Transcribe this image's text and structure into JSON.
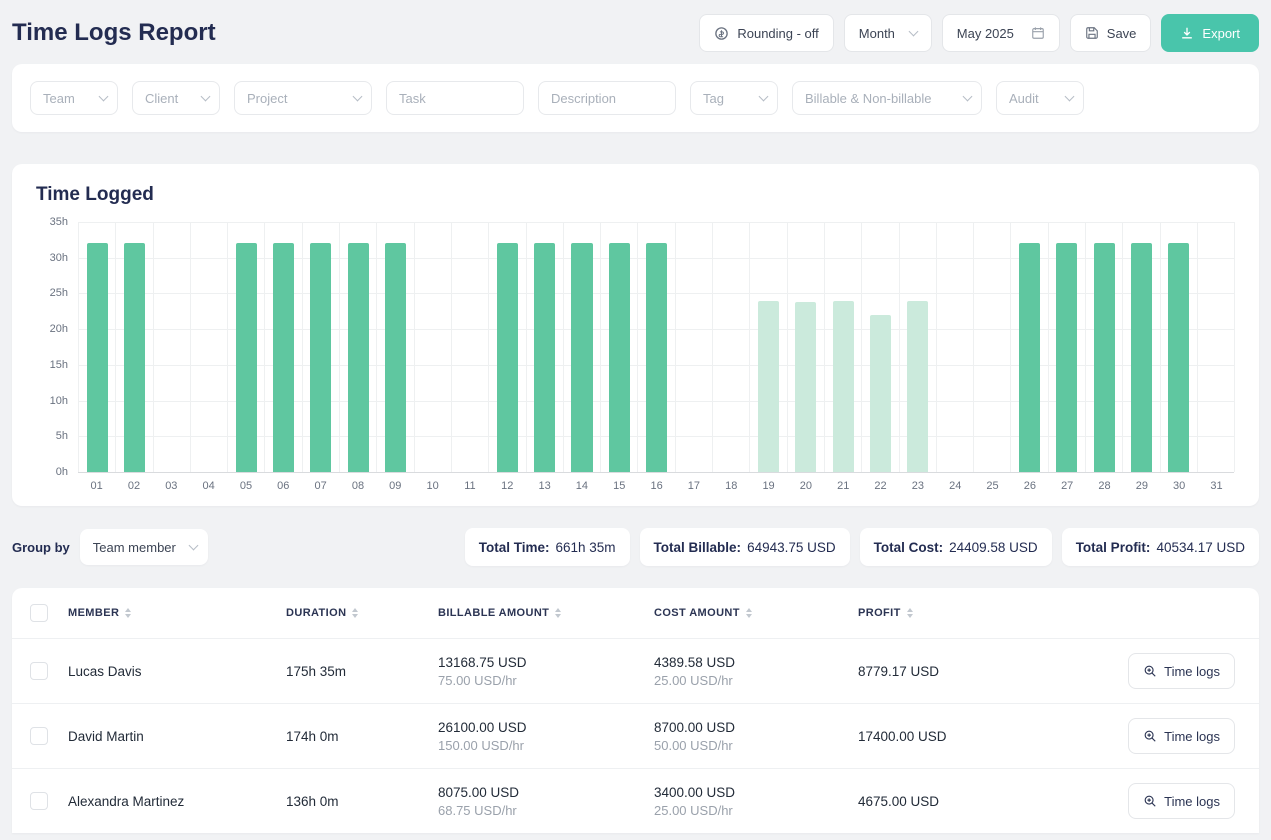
{
  "page": {
    "title": "Time Logs Report"
  },
  "header": {
    "rounding": "Rounding - off",
    "period": "Month",
    "date": "May 2025",
    "save": "Save",
    "export": "Export"
  },
  "filters": {
    "team": "Team",
    "client": "Client",
    "project": "Project",
    "task": "Task",
    "description": "Description",
    "tag": "Tag",
    "billable": "Billable & Non-billable",
    "audit": "Audit"
  },
  "chart_data": {
    "type": "bar",
    "title": "Time Logged",
    "categories": [
      "01",
      "02",
      "03",
      "04",
      "05",
      "06",
      "07",
      "08",
      "09",
      "10",
      "11",
      "12",
      "13",
      "14",
      "15",
      "16",
      "17",
      "18",
      "19",
      "20",
      "21",
      "22",
      "23",
      "24",
      "25",
      "26",
      "27",
      "28",
      "29",
      "30",
      "31"
    ],
    "values": [
      32,
      32,
      0,
      0,
      32,
      32,
      32,
      32,
      32,
      0,
      0,
      32,
      32,
      32,
      32,
      32,
      0,
      0,
      24,
      23.8,
      24,
      22,
      24,
      0,
      0,
      32,
      32,
      32,
      32,
      32,
      0
    ],
    "muted_days": [
      "19",
      "20",
      "21",
      "22",
      "23"
    ],
    "y_ticks": [
      "35h",
      "30h",
      "25h",
      "20h",
      "15h",
      "10h",
      "5h",
      "0h"
    ],
    "ylim": [
      0,
      35
    ],
    "grid": true,
    "bar_color": "#5fc7a0",
    "bar_color_muted": "#cbeadc"
  },
  "summary": {
    "group_by_label": "Group by",
    "group_by_value": "Team member",
    "stats": [
      {
        "label": "Total Time:",
        "value": "661h 35m"
      },
      {
        "label": "Total Billable:",
        "value": "64943.75 USD"
      },
      {
        "label": "Total Cost:",
        "value": "24409.58 USD"
      },
      {
        "label": "Total Profit:",
        "value": "40534.17 USD"
      }
    ]
  },
  "table": {
    "headers": {
      "member": "MEMBER",
      "duration": "DURATION",
      "billable": "BILLABLE AMOUNT",
      "cost": "COST AMOUNT",
      "profit": "PROFIT"
    },
    "action_label": "Time logs",
    "rows": [
      {
        "member": "Lucas Davis",
        "duration": "175h 35m",
        "billable": "13168.75 USD",
        "billable_rate": "75.00 USD/hr",
        "cost": "4389.58 USD",
        "cost_rate": "25.00 USD/hr",
        "profit": "8779.17 USD"
      },
      {
        "member": "David Martin",
        "duration": "174h 0m",
        "billable": "26100.00 USD",
        "billable_rate": "150.00 USD/hr",
        "cost": "8700.00 USD",
        "cost_rate": "50.00 USD/hr",
        "profit": "17400.00 USD"
      },
      {
        "member": "Alexandra Martinez",
        "duration": "136h 0m",
        "billable": "8075.00 USD",
        "billable_rate": "68.75 USD/hr",
        "cost": "3400.00 USD",
        "cost_rate": "25.00 USD/hr",
        "profit": "4675.00 USD"
      }
    ]
  }
}
